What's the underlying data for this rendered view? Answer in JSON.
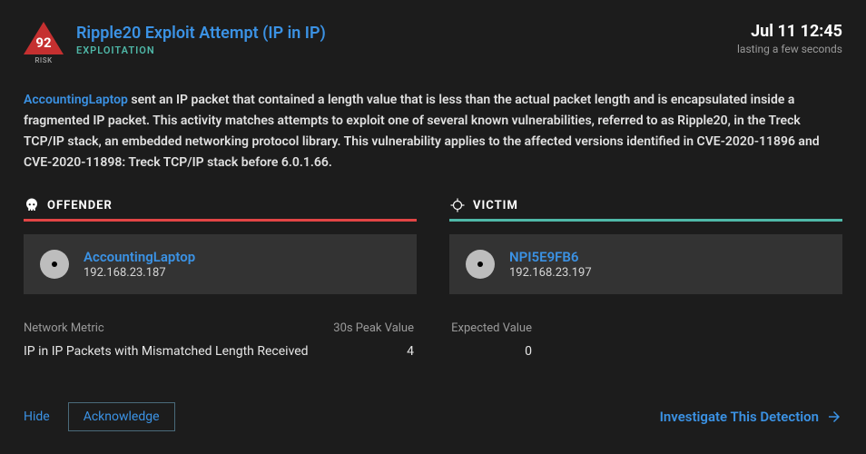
{
  "risk": {
    "score": "92",
    "label": "RISK"
  },
  "title": "Ripple20 Exploit Attempt (IP in IP)",
  "category": "EXPLOITATION",
  "timestamp": "Jul 11 12:45",
  "duration": "lasting a few seconds",
  "description": {
    "link_text": "AccountingLaptop",
    "body": " sent an IP packet that contained a length value that is less than the actual packet length and is encapsulated inside a fragmented IP packet. This activity matches attempts to exploit one of several known vulnerabilities, referred to as Ripple20, in the Treck TCP/IP stack, an embedded networking protocol library. This vulnerability applies to the affected versions identified in CVE-2020-11896 and CVE-2020-11898: Treck TCP/IP stack before 6.0.1.66."
  },
  "offender": {
    "section_label": "OFFENDER",
    "name": "AccountingLaptop",
    "ip": "192.168.23.187"
  },
  "victim": {
    "section_label": "VICTIM",
    "name": "NPI5E9FB6",
    "ip": "192.168.23.197"
  },
  "metrics": {
    "headers": {
      "metric": "Network Metric",
      "peak": "30s Peak Value",
      "expected": "Expected Value"
    },
    "rows": [
      {
        "metric": "IP in IP Packets with Mismatched Length Received",
        "peak": "4",
        "expected": "0"
      }
    ]
  },
  "actions": {
    "hide": "Hide",
    "acknowledge": "Acknowledge",
    "investigate": "Investigate This Detection"
  }
}
